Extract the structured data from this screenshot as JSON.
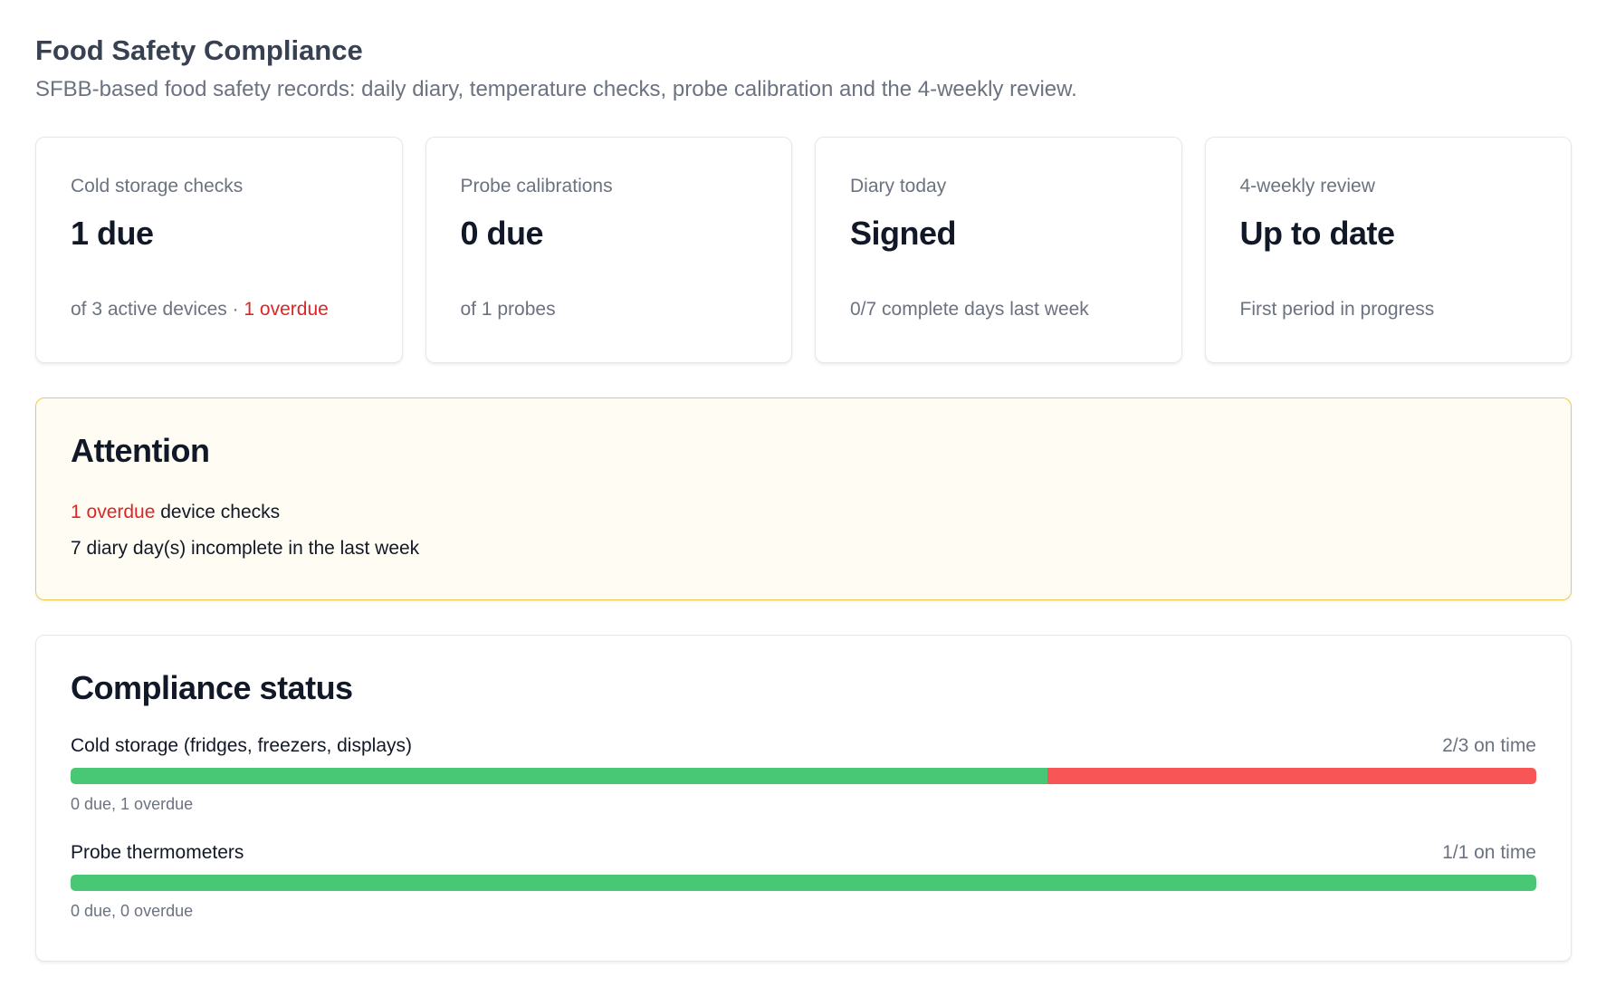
{
  "header": {
    "title": "Food Safety Compliance",
    "subtitle": "SFBB-based food safety records: daily diary, temperature checks, probe calibration and the 4-weekly review."
  },
  "cards": [
    {
      "label": "Cold storage checks",
      "value": "1 due",
      "note": "of 3 active devices · ",
      "note_alert": "1 overdue"
    },
    {
      "label": "Probe calibrations",
      "value": "0 due",
      "note": "of 1 probes",
      "note_alert": ""
    },
    {
      "label": "Diary today",
      "value": "Signed",
      "note": "0/7 complete days last week",
      "note_alert": ""
    },
    {
      "label": "4-weekly review",
      "value": "Up to date",
      "note": "First period in progress",
      "note_alert": ""
    }
  ],
  "attention": {
    "title": "Attention",
    "items": [
      {
        "alert": "1 overdue",
        "text": " device checks"
      },
      {
        "alert": "",
        "text": "7 diary day(s) incomplete in the last week"
      }
    ]
  },
  "compliance": {
    "title": "Compliance status",
    "rows": [
      {
        "label": "Cold storage (fridges, freezers, displays)",
        "ratio": "2/3 on time",
        "detail": "0 due, 1 overdue",
        "on_time": 2,
        "total": 3
      },
      {
        "label": "Probe thermometers",
        "ratio": "1/1 on time",
        "detail": "0 due, 0 overdue",
        "on_time": 1,
        "total": 1
      }
    ]
  },
  "colors": {
    "ok": "#48c774",
    "overdue": "#f85656",
    "alert_text": "#dc2626",
    "attention_border": "#f0c94a",
    "attention_bg": "#fffcf4"
  }
}
